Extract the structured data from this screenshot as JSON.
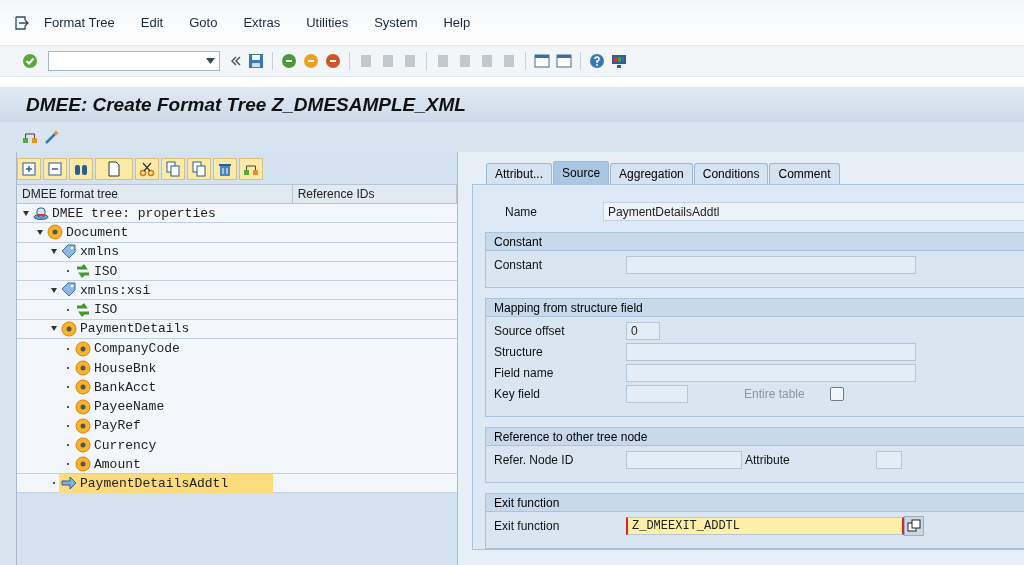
{
  "menu": [
    "Format Tree",
    "Edit",
    "Goto",
    "Extras",
    "Utilities",
    "System",
    "Help"
  ],
  "title": "DMEE: Create Format Tree Z_DMESAMPLE_XML",
  "tree": {
    "columns": [
      "DMEE format tree",
      "Reference IDs"
    ],
    "nodes": [
      {
        "label": "DMEE tree: properties",
        "kind": "root",
        "expanded": true,
        "selected": false,
        "children": [
          {
            "label": "Document",
            "kind": "element",
            "expanded": true,
            "selected": false,
            "children": [
              {
                "label": "xmlns",
                "kind": "attribute",
                "expanded": true,
                "selected": false,
                "children": [
                  {
                    "label": "ISO",
                    "kind": "atom",
                    "expanded": false,
                    "selected": false
                  }
                ]
              },
              {
                "label": "xmlns:xsi",
                "kind": "attribute",
                "expanded": true,
                "selected": false,
                "children": [
                  {
                    "label": "ISO",
                    "kind": "atom",
                    "expanded": false,
                    "selected": false
                  }
                ]
              },
              {
                "label": "PaymentDetails",
                "kind": "element",
                "expanded": true,
                "selected": false,
                "children": [
                  {
                    "label": "CompanyCode",
                    "kind": "element",
                    "expanded": false,
                    "selected": false
                  },
                  {
                    "label": "HouseBnk",
                    "kind": "element",
                    "expanded": false,
                    "selected": false
                  },
                  {
                    "label": "BankAcct",
                    "kind": "element",
                    "expanded": false,
                    "selected": false
                  },
                  {
                    "label": "PayeeName",
                    "kind": "element",
                    "expanded": false,
                    "selected": false
                  },
                  {
                    "label": "PayRef",
                    "kind": "element",
                    "expanded": false,
                    "selected": false
                  },
                  {
                    "label": "Currency",
                    "kind": "element",
                    "expanded": false,
                    "selected": false
                  },
                  {
                    "label": "Amount",
                    "kind": "element",
                    "expanded": false,
                    "selected": false
                  }
                ]
              },
              {
                "label": "PaymentDetailsAddtl",
                "kind": "reference",
                "expanded": false,
                "selected": true
              }
            ]
          }
        ]
      }
    ]
  },
  "tabs": [
    {
      "label": "Attribut...",
      "selected": false
    },
    {
      "label": "Source",
      "selected": true
    },
    {
      "label": "Aggregation",
      "selected": false
    },
    {
      "label": "Conditions",
      "selected": false
    },
    {
      "label": "Comment",
      "selected": false
    }
  ],
  "name": {
    "label": "Name",
    "value": "PaymentDetailsAddtl"
  },
  "sections": [
    {
      "title": "Constant",
      "rows": [
        {
          "kind": "text",
          "label": "Constant",
          "value": ""
        }
      ]
    },
    {
      "title": "Mapping from structure field",
      "rows": [
        {
          "kind": "number",
          "label": "Source offset",
          "value": "0"
        },
        {
          "kind": "text",
          "label": "Structure",
          "value": ""
        },
        {
          "kind": "text",
          "label": "Field name",
          "value": ""
        },
        {
          "kind": "key",
          "label": "Key field",
          "value": "",
          "option": {
            "label": "Entire table",
            "disabled": true,
            "checked": false
          }
        }
      ]
    },
    {
      "title": "Reference to other tree node",
      "rows": [
        {
          "kind": "ref",
          "label": "Refer. Node ID",
          "value": "",
          "second_label": "Attribute",
          "second_value": ""
        }
      ]
    },
    {
      "title": "Exit function",
      "rows": [
        {
          "kind": "exit",
          "label": "Exit function",
          "value": "Z_DMEEXIT_ADDTL",
          "focused": true
        }
      ]
    }
  ]
}
